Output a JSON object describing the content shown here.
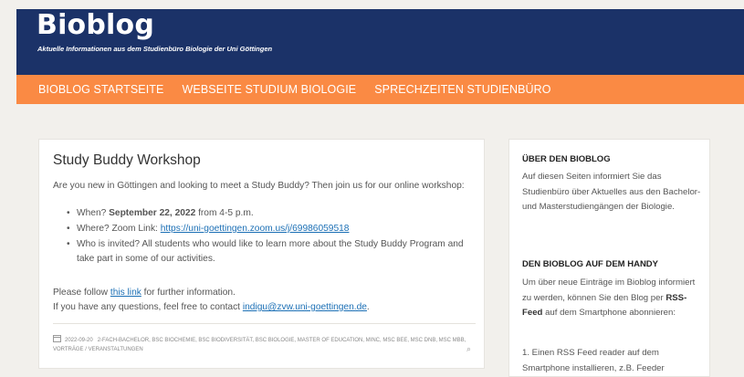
{
  "site": {
    "title": "Bioblog",
    "description": "Aktuelle Informationen aus dem Studienbüro Biologie der Uni Göttingen"
  },
  "nav": {
    "items": [
      {
        "label": "BIOBLOG STARTSEITE"
      },
      {
        "label": "WEBSEITE STUDIUM BIOLOGIE"
      },
      {
        "label": "SPRECHZEITEN STUDIENBÜRO"
      }
    ]
  },
  "post": {
    "title": "Study Buddy Workshop",
    "intro": "Are you new in Göttingen and looking to meet a Study Buddy? Then join us for our online workshop:",
    "when_prefix": "When? ",
    "when_date": "September 22, 2022",
    "when_suffix": " from 4-5 p.m.",
    "where_prefix": "Where? Zoom Link: ",
    "where_link": "https://uni-goettingen.zoom.us/j/69986059518",
    "who": "Who is invited? All students who would like to learn more about the Study Buddy Program and take part in some of our activities.",
    "follow_prefix": "Please follow ",
    "follow_link": "this link",
    "follow_suffix": " for further information.",
    "contact_prefix": "If you have any questions, feel free to contact ",
    "contact_email": "indigu@zvw.uni-goettingen.de",
    "contact_suffix": ".",
    "meta_date": "2022-09-20",
    "meta_categories": "2-FACH-BACHELOR, BSC BIOCHEMIE, BSC BIODIVERSITÄT, BSC BIOLOGIE, MASTER OF EDUCATION, MINC, MSC BEE, MSC DNB, MSC MBB, VORTRÄGE / VERANSTALTUNGEN"
  },
  "sidebar": {
    "about_title": "ÜBER DEN BIOBLOG",
    "about_text": "Auf diesen Seiten informiert Sie das Studienbüro über Aktuelles aus den Bachelor- und Masterstudiengängen der Biologie.",
    "mobile_title": "DEN BIOBLOG AUF DEM HANDY",
    "mobile_text_prefix": "Um über neue Einträge im Bioblog informiert zu werden, können Sie den Blog per ",
    "mobile_text_bold": "RSS-Feed",
    "mobile_text_suffix": " auf dem Smartphone abonnieren:",
    "step1": "1. Einen RSS Feed reader auf dem Smartphone installieren, z.B. Feeder"
  },
  "colors": {
    "header_bg": "#1b3268",
    "nav_bg": "#fa8a44",
    "page_bg": "#f2f0ec",
    "link": "#1b6fb5"
  }
}
